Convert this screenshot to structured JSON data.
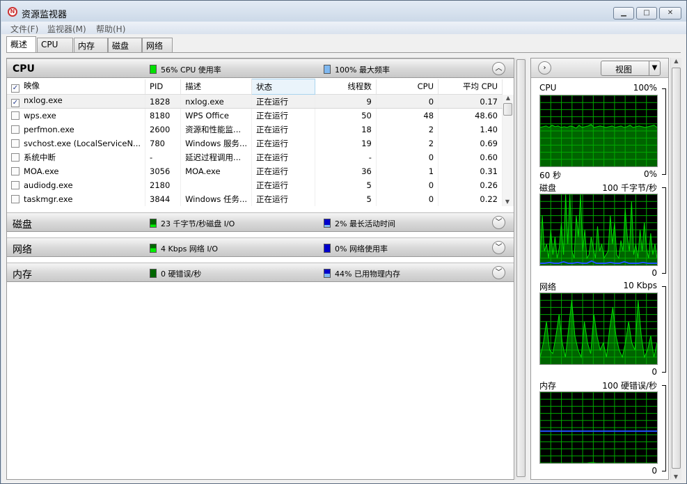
{
  "window": {
    "title": "资源监视器",
    "minimize": "▁",
    "maximize": "□",
    "close": "✕"
  },
  "menu": [
    "文件(F)",
    "监视器(M)",
    "帮助(H)"
  ],
  "tabs": [
    "概述",
    "CPU",
    "内存",
    "磁盘",
    "网络"
  ],
  "active_tab": "概述",
  "cpu": {
    "title": "CPU",
    "legend1": "56% CPU 使用率",
    "legend2": "100% 最大频率",
    "columns": [
      "映像",
      "PID",
      "描述",
      "状态",
      "线程数",
      "CPU",
      "平均 CPU"
    ],
    "rows": [
      {
        "checked": true,
        "image": "nxlog.exe",
        "pid": "1828",
        "desc": "nxlog.exe",
        "status": "正在运行",
        "threads": "9",
        "cpu": "0",
        "avg": "0.17"
      },
      {
        "checked": false,
        "image": "wps.exe",
        "pid": "8180",
        "desc": "WPS Office",
        "status": "正在运行",
        "threads": "50",
        "cpu": "48",
        "avg": "48.60"
      },
      {
        "checked": false,
        "image": "perfmon.exe",
        "pid": "2600",
        "desc": "资源和性能监...",
        "status": "正在运行",
        "threads": "18",
        "cpu": "2",
        "avg": "1.40"
      },
      {
        "checked": false,
        "image": "svchost.exe (LocalServiceN...",
        "pid": "780",
        "desc": "Windows 服务...",
        "status": "正在运行",
        "threads": "19",
        "cpu": "2",
        "avg": "0.69"
      },
      {
        "checked": false,
        "image": "系统中断",
        "pid": "-",
        "desc": "延迟过程调用...",
        "status": "正在运行",
        "threads": "-",
        "cpu": "0",
        "avg": "0.60"
      },
      {
        "checked": false,
        "image": "MOA.exe",
        "pid": "3056",
        "desc": "MOA.exe",
        "status": "正在运行",
        "threads": "36",
        "cpu": "1",
        "avg": "0.31"
      },
      {
        "checked": false,
        "image": "audiodg.exe",
        "pid": "2180",
        "desc": "",
        "status": "正在运行",
        "threads": "5",
        "cpu": "0",
        "avg": "0.26"
      },
      {
        "checked": false,
        "image": "taskmgr.exe",
        "pid": "3844",
        "desc": "Windows 任务...",
        "status": "正在运行",
        "threads": "5",
        "cpu": "0",
        "avg": "0.22"
      }
    ]
  },
  "disk": {
    "title": "磁盘",
    "legend1": "23 千字节/秒磁盘 I/O",
    "legend2": "2% 最长活动时间"
  },
  "network": {
    "title": "网络",
    "legend1": "4 Kbps 网络 I/O",
    "legend2": "0% 网络使用率"
  },
  "memory": {
    "title": "内存",
    "legend1": "0 硬错误/秒",
    "legend2": "44% 已用物理内存"
  },
  "colors": {
    "green": "#00e000",
    "darkgreen": "#006400",
    "blue": "#2050ff",
    "lightblue": "#7fb8f0"
  },
  "right": {
    "view_button": "视图",
    "graphs": [
      {
        "label": "CPU",
        "max": "100%",
        "time": "60 秒",
        "min": "0%",
        "series": [
          55,
          56,
          57,
          55,
          58,
          56,
          57,
          55,
          56,
          55,
          57,
          56,
          54,
          58,
          55,
          56,
          57,
          59,
          55,
          56,
          57,
          56,
          55,
          56,
          57,
          55,
          56,
          57,
          55,
          56,
          58,
          55,
          56,
          57,
          56,
          55,
          56,
          57,
          58,
          55
        ],
        "series2": []
      },
      {
        "label": "磁盘",
        "max": "100 千字节/秒",
        "min": "0",
        "series": [
          10,
          70,
          20,
          30,
          10,
          50,
          15,
          40,
          10,
          25,
          60,
          15,
          100,
          30,
          100,
          20,
          10,
          70,
          40,
          100,
          20,
          50,
          10,
          15,
          40,
          25,
          10,
          55,
          20,
          30,
          10,
          15,
          20,
          70,
          30,
          60,
          15,
          10,
          35,
          20,
          80,
          40,
          20,
          90,
          15,
          30,
          10,
          50,
          20,
          60,
          25,
          10,
          45,
          15,
          30,
          10
        ],
        "series2": [
          2,
          2,
          3,
          2,
          2,
          4,
          2,
          2,
          3,
          2,
          2,
          5,
          2,
          2,
          2,
          3,
          2,
          2,
          4,
          2,
          2,
          2,
          3,
          2,
          2,
          2
        ]
      },
      {
        "label": "网络",
        "max": "10 Kbps",
        "min": "0",
        "series": [
          10,
          30,
          60,
          20,
          15,
          40,
          70,
          30,
          10,
          50,
          90,
          40,
          20,
          10,
          60,
          30,
          15,
          70,
          40,
          20,
          30,
          10,
          50,
          80,
          40,
          20,
          10,
          30,
          60,
          30,
          20,
          90,
          40,
          10,
          20,
          40,
          10,
          30
        ],
        "series2": []
      },
      {
        "label": "内存",
        "max": "100 硬错误/秒",
        "min": "0",
        "series": [
          0,
          0,
          0,
          0,
          0,
          0,
          0,
          0,
          0,
          0,
          0,
          1,
          0,
          0,
          0,
          0,
          0,
          0,
          0,
          0,
          0,
          0,
          0,
          0,
          0,
          0
        ],
        "series2": [
          44,
          44,
          44,
          44,
          44,
          44,
          44,
          44
        ]
      }
    ]
  }
}
